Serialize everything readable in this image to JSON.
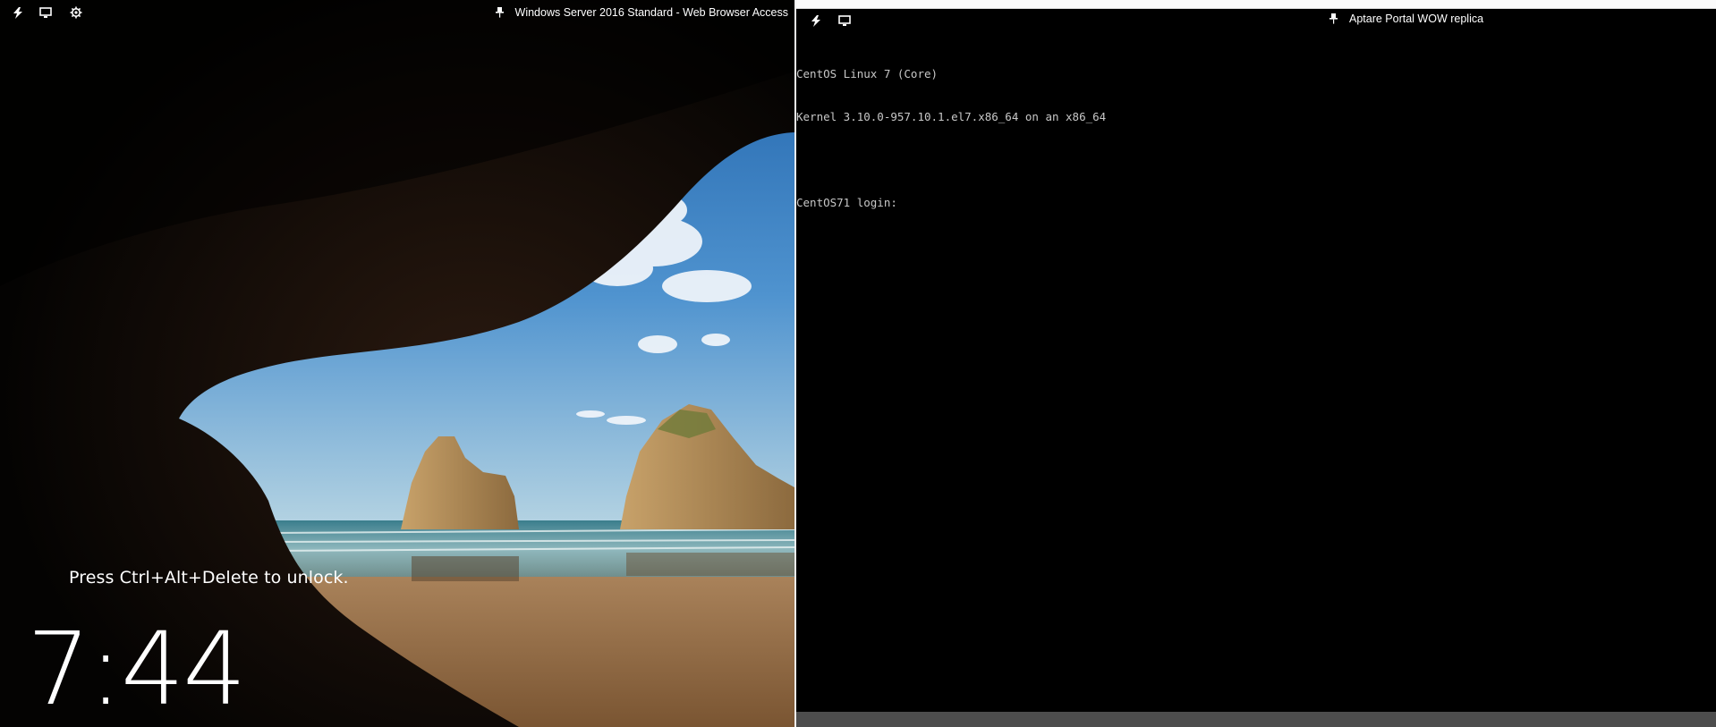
{
  "left_session": {
    "title": "Windows Server 2016 Standard - Web Browser Access",
    "toolbar_icons": [
      "lightning-icon",
      "monitor-icon",
      "gear-icon",
      "pin-icon"
    ],
    "lock_screen": {
      "unlock_message": "Press Ctrl+Alt+Delete to unlock.",
      "clock": "7:44"
    }
  },
  "right_session": {
    "title": "Aptare Portal WOW replica",
    "toolbar_icons": [
      "lightning-icon",
      "monitor-icon",
      "pin-icon"
    ],
    "console": {
      "lines": [
        "CentOS Linux 7 (Core)",
        "Kernel 3.10.0-957.10.1.el7.x86_64 on an x86_64",
        "",
        "CentOS71 login: "
      ]
    }
  },
  "colors": {
    "console_bg": "#000000",
    "console_fg": "#c8c8c8",
    "toolbar_fg": "#ffffff",
    "status_bar": "#4d4d4d"
  }
}
